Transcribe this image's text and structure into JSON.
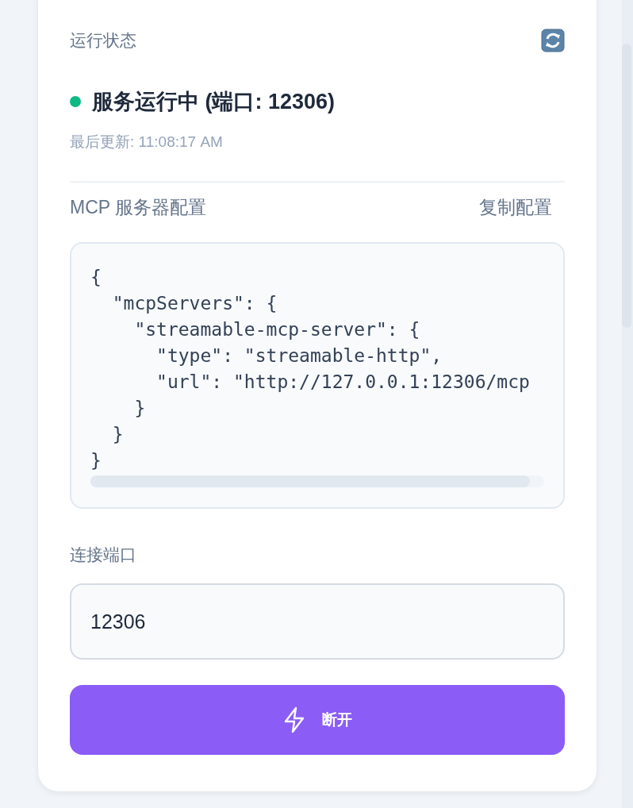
{
  "status_section": {
    "title": "运行状态",
    "status": {
      "text": "服务运行中 (端口: 12306)",
      "running": true,
      "color": "#10b981"
    },
    "last_updated": "最后更新: 11:08:17 AM"
  },
  "config_section": {
    "title": "MCP 服务器配置",
    "copy_action": "复制配置",
    "code_lines": [
      "{",
      "  \"mcpServers\": {",
      "    \"streamable-mcp-server\": {",
      "      \"type\": \"streamable-http\",",
      "      \"url\": \"http://127.0.0.1:12306/mcp",
      "    }",
      "  }",
      "}"
    ]
  },
  "port_field": {
    "label": "连接端口",
    "value": "12306"
  },
  "disconnect_button": {
    "label": "断开"
  }
}
